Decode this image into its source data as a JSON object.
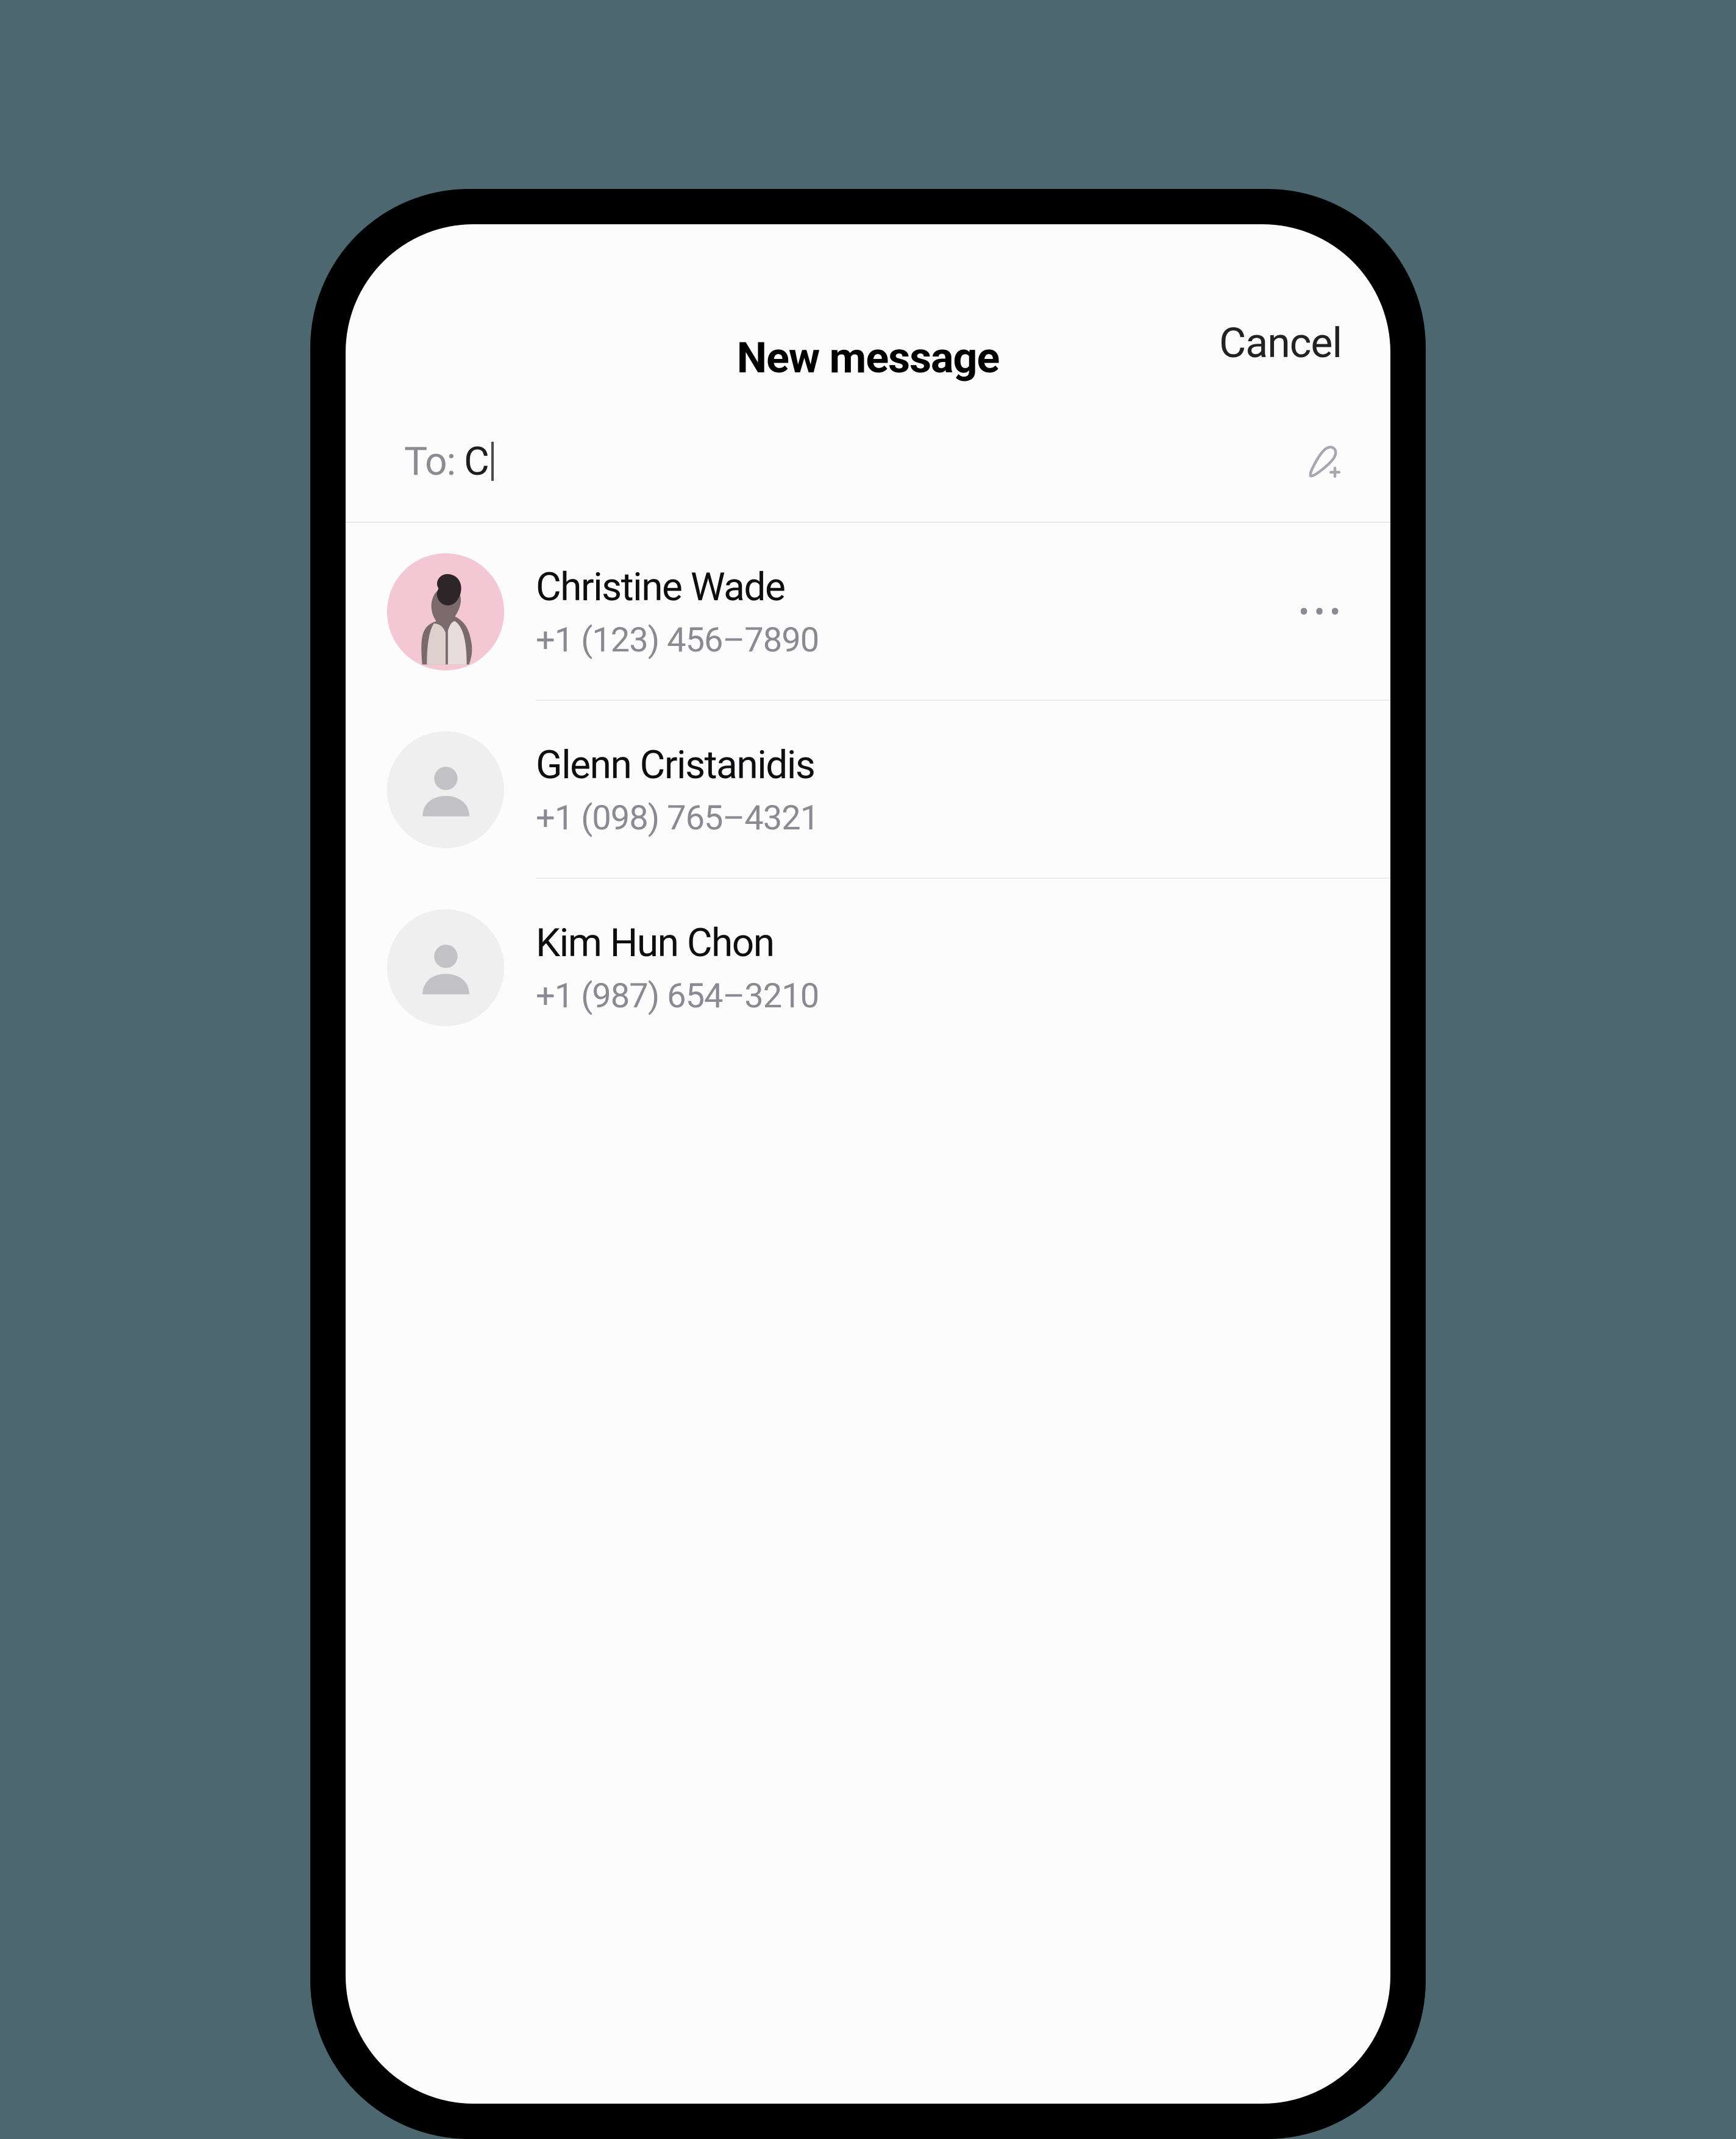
{
  "header": {
    "title": "New message",
    "cancel_label": "Cancel"
  },
  "compose": {
    "to_label": "To:",
    "to_value": "C"
  },
  "contacts": [
    {
      "name": "Christine Wade",
      "phone": "+1 (123) 456–7890",
      "has_photo": true,
      "show_more": true
    },
    {
      "name": "Glenn Cristanidis",
      "phone": "+1 (098) 765–4321",
      "has_photo": false,
      "show_more": false
    },
    {
      "name": "Kim Hun Chon",
      "phone": "+1 (987) 654–3210",
      "has_photo": false,
      "show_more": false
    }
  ]
}
